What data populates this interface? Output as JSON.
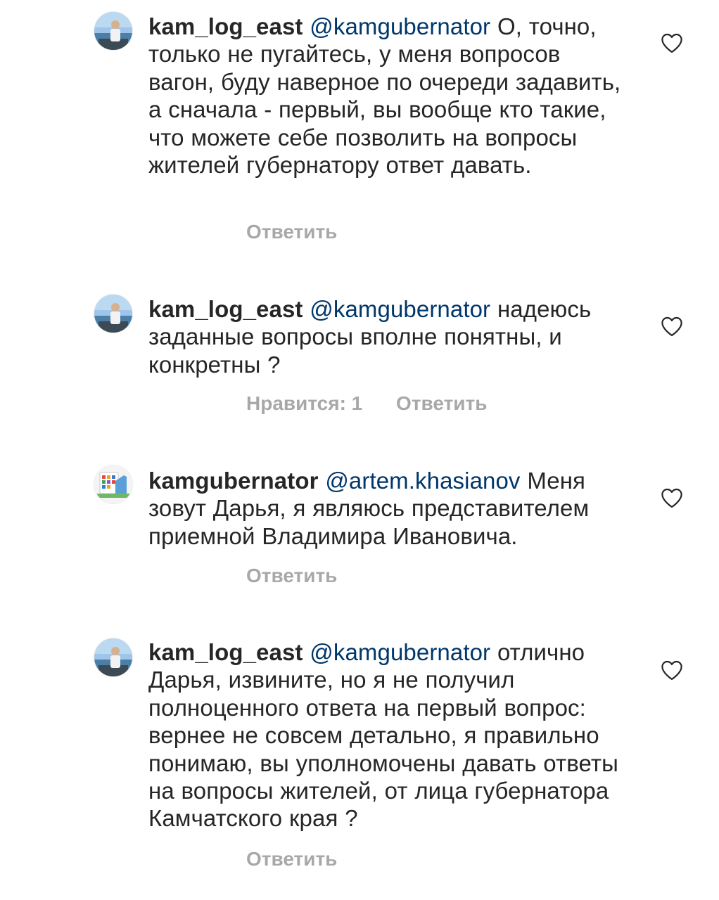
{
  "colors": {
    "text": "#262626",
    "mention": "#00376b",
    "secondary": "#a8a8a8",
    "background": "#ffffff"
  },
  "comments": [
    {
      "username": "kam_log_east",
      "mention": "@kamgubernator",
      "text": "О, точно, только не пугайтесь, у меня вопросов вагон, буду наверное по очереди задавить, а сначала - первый, вы вообще кто такие, что можете себе позволить на вопросы жителей губернатору ответ давать.",
      "reply_label": "Ответить",
      "avatar_icon": "profile-photo-avatar",
      "like_icon": "heart-outline-icon"
    },
    {
      "username": "kam_log_east",
      "mention": "@kamgubernator",
      "text": "надеюсь заданные вопросы вполне понятны, и конкретны ?",
      "likes_label": "Нравится: 1",
      "reply_label": "Ответить",
      "avatar_icon": "profile-photo-avatar",
      "like_icon": "heart-outline-icon"
    },
    {
      "username": "kamgubernator",
      "mention": "@artem.khasianov",
      "text": "Меня зовут Дарья, я являюсь представителем приемной Владимира Ивановича.",
      "reply_label": "Ответить",
      "avatar_icon": "government-building-avatar",
      "like_icon": "heart-outline-icon"
    },
    {
      "username": "kam_log_east",
      "mention": "@kamgubernator",
      "text": "отлично Дарья, извините, но я не получил полноценного ответа на первый вопрос: вернее не совсем детально, я правильно понимаю, вы уполномочены давать ответы на вопросы жителей, от лица губернатора Камчатского края ?",
      "reply_label": "Ответить",
      "avatar_icon": "profile-photo-avatar",
      "like_icon": "heart-outline-icon"
    }
  ]
}
